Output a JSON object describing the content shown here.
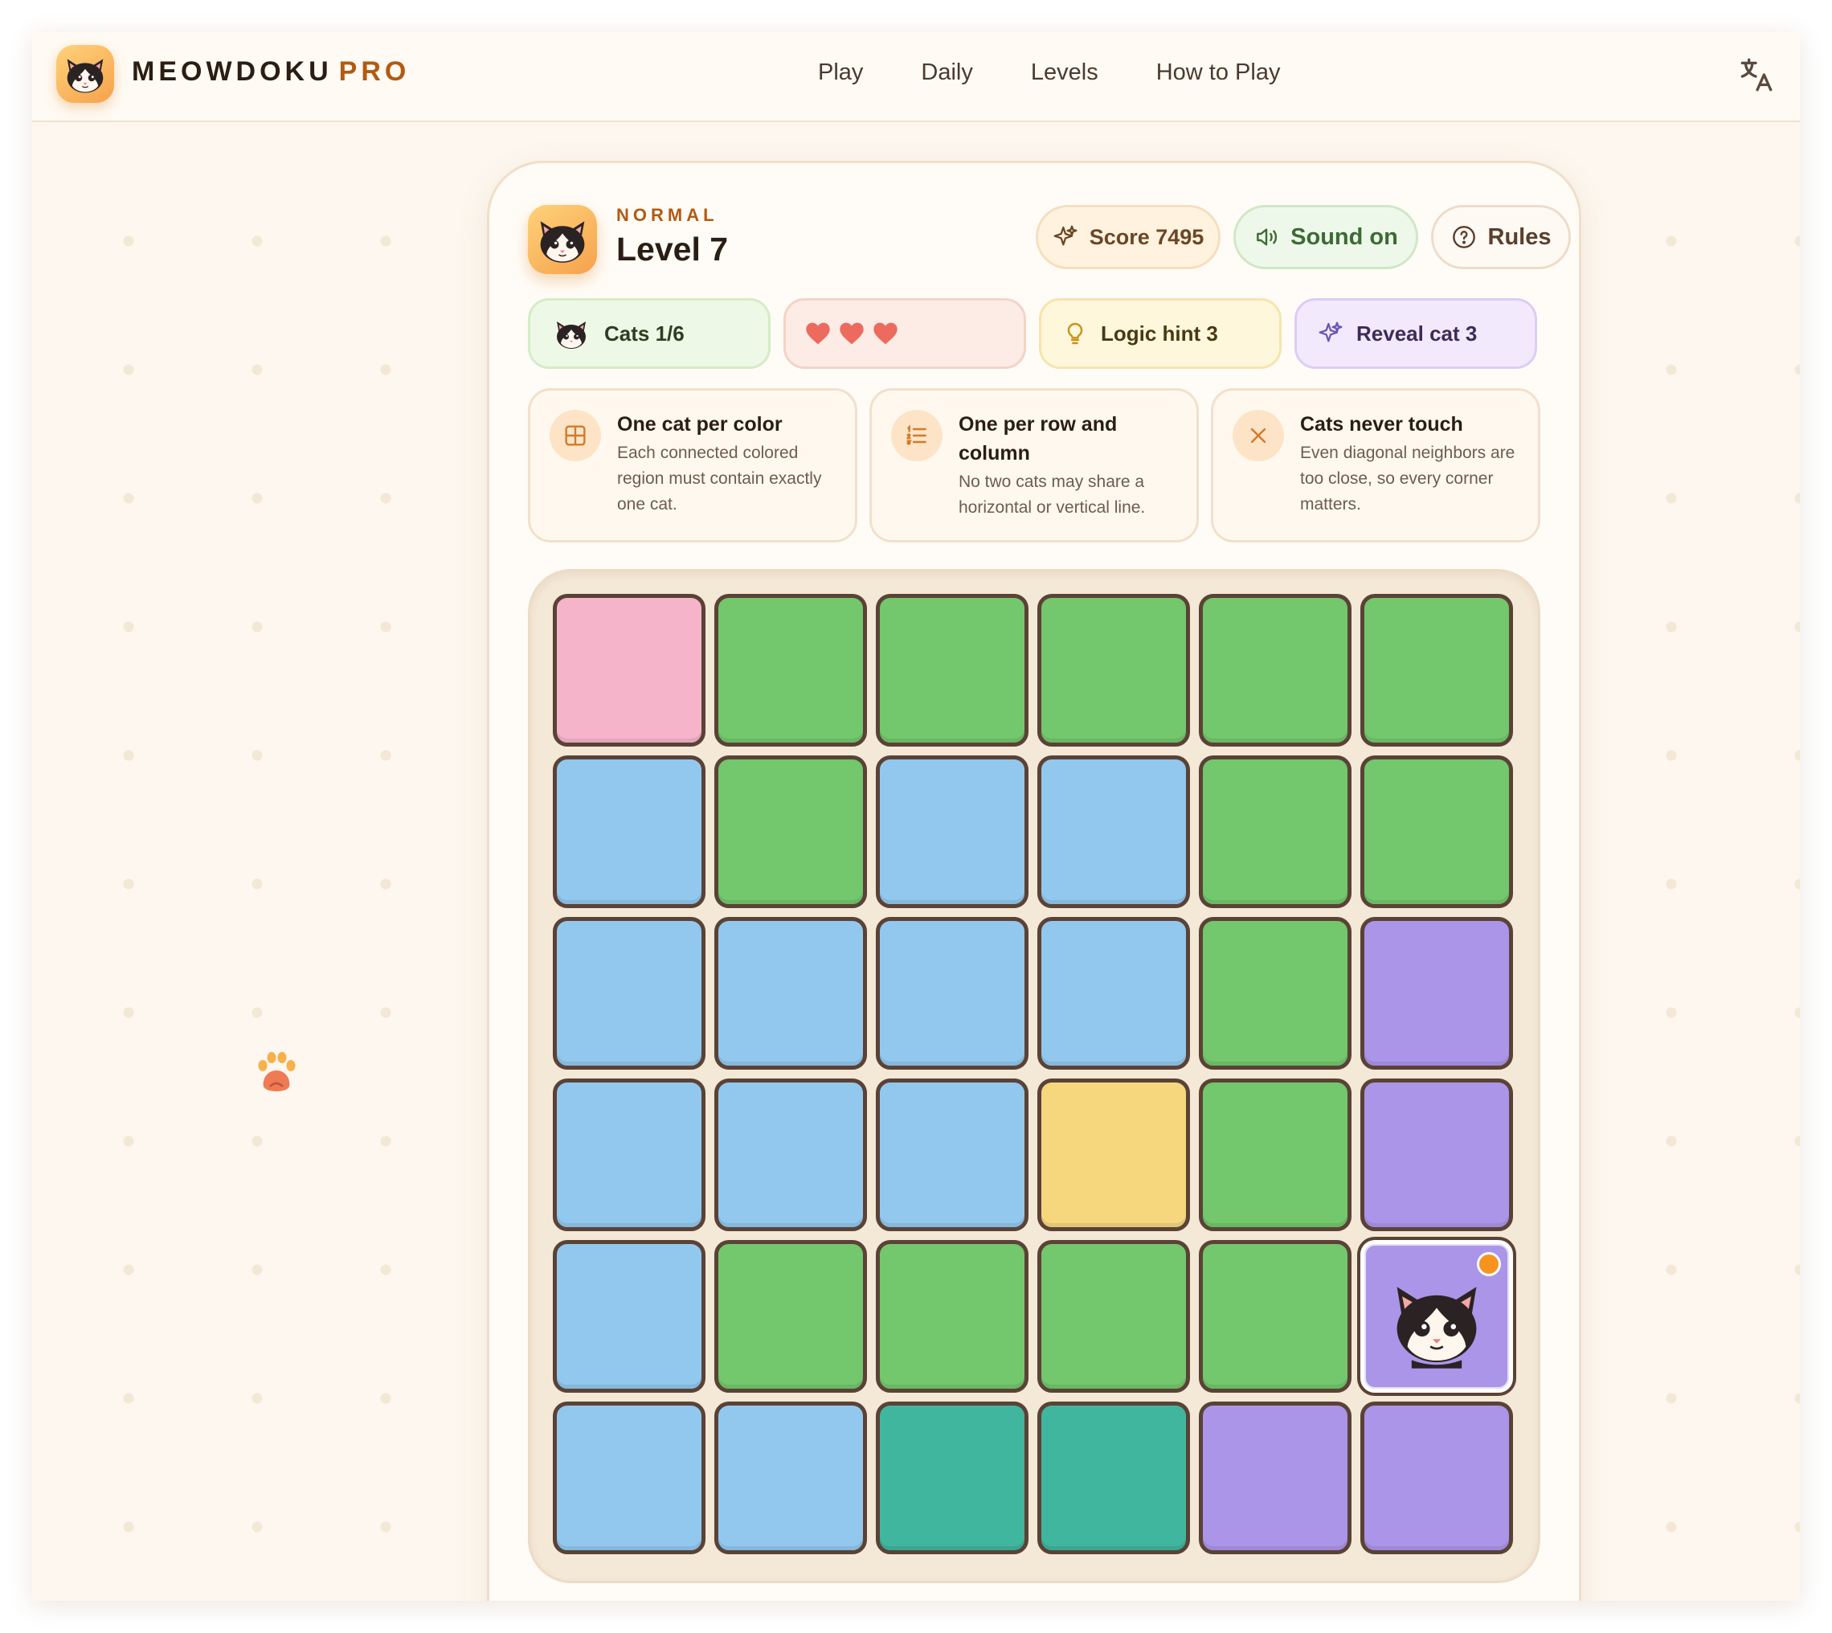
{
  "nav": {
    "brand": "MEOWDOKU",
    "brand_suffix": "PRO",
    "links": [
      "Play",
      "Daily",
      "Levels",
      "How to Play"
    ],
    "language_icon": "translate-icon"
  },
  "level": {
    "difficulty": "NORMAL",
    "title": "Level 7"
  },
  "actions": {
    "score_label": "Score 7495",
    "sound_label": "Sound on",
    "rules_label": "Rules"
  },
  "stats": {
    "cats_label": "Cats 1/6",
    "lives": 3,
    "hint_label": "Logic hint 3",
    "reveal_label": "Reveal cat 3"
  },
  "rules": [
    {
      "title": "One cat per color",
      "desc": "Each connected colored region must contain exactly one cat.",
      "icon": "grid-icon"
    },
    {
      "title": "One per row and column",
      "desc": "No two cats may share a horizontal or vertical line.",
      "icon": "list-icon"
    },
    {
      "title": "Cats never touch",
      "desc": "Even diagonal neighbors are too close, so every corner matters.",
      "icon": "close-icon"
    }
  ],
  "colors": {
    "pink": "#f6b4ca",
    "green": "#73c76d",
    "blue": "#92c8ee",
    "purple": "#ab95e9",
    "yellow": "#f7d77e",
    "teal": "#40b69e",
    "accent": "#b25a12",
    "hint_dot": "#f7931e"
  },
  "board": {
    "rows": 6,
    "cols": 6,
    "cells": [
      [
        "pink",
        "green",
        "green",
        "green",
        "green",
        "green"
      ],
      [
        "blue",
        "green",
        "blue",
        "blue",
        "green",
        "green"
      ],
      [
        "blue",
        "blue",
        "blue",
        "blue",
        "green",
        "purple"
      ],
      [
        "blue",
        "blue",
        "blue",
        "yellow",
        "green",
        "purple"
      ],
      [
        "blue",
        "green",
        "green",
        "green",
        "green",
        "purple"
      ],
      [
        "blue",
        "blue",
        "teal",
        "teal",
        "purple",
        "purple"
      ]
    ],
    "cats": [
      {
        "row": 4,
        "col": 5
      }
    ],
    "selected": {
      "row": 4,
      "col": 5
    }
  }
}
